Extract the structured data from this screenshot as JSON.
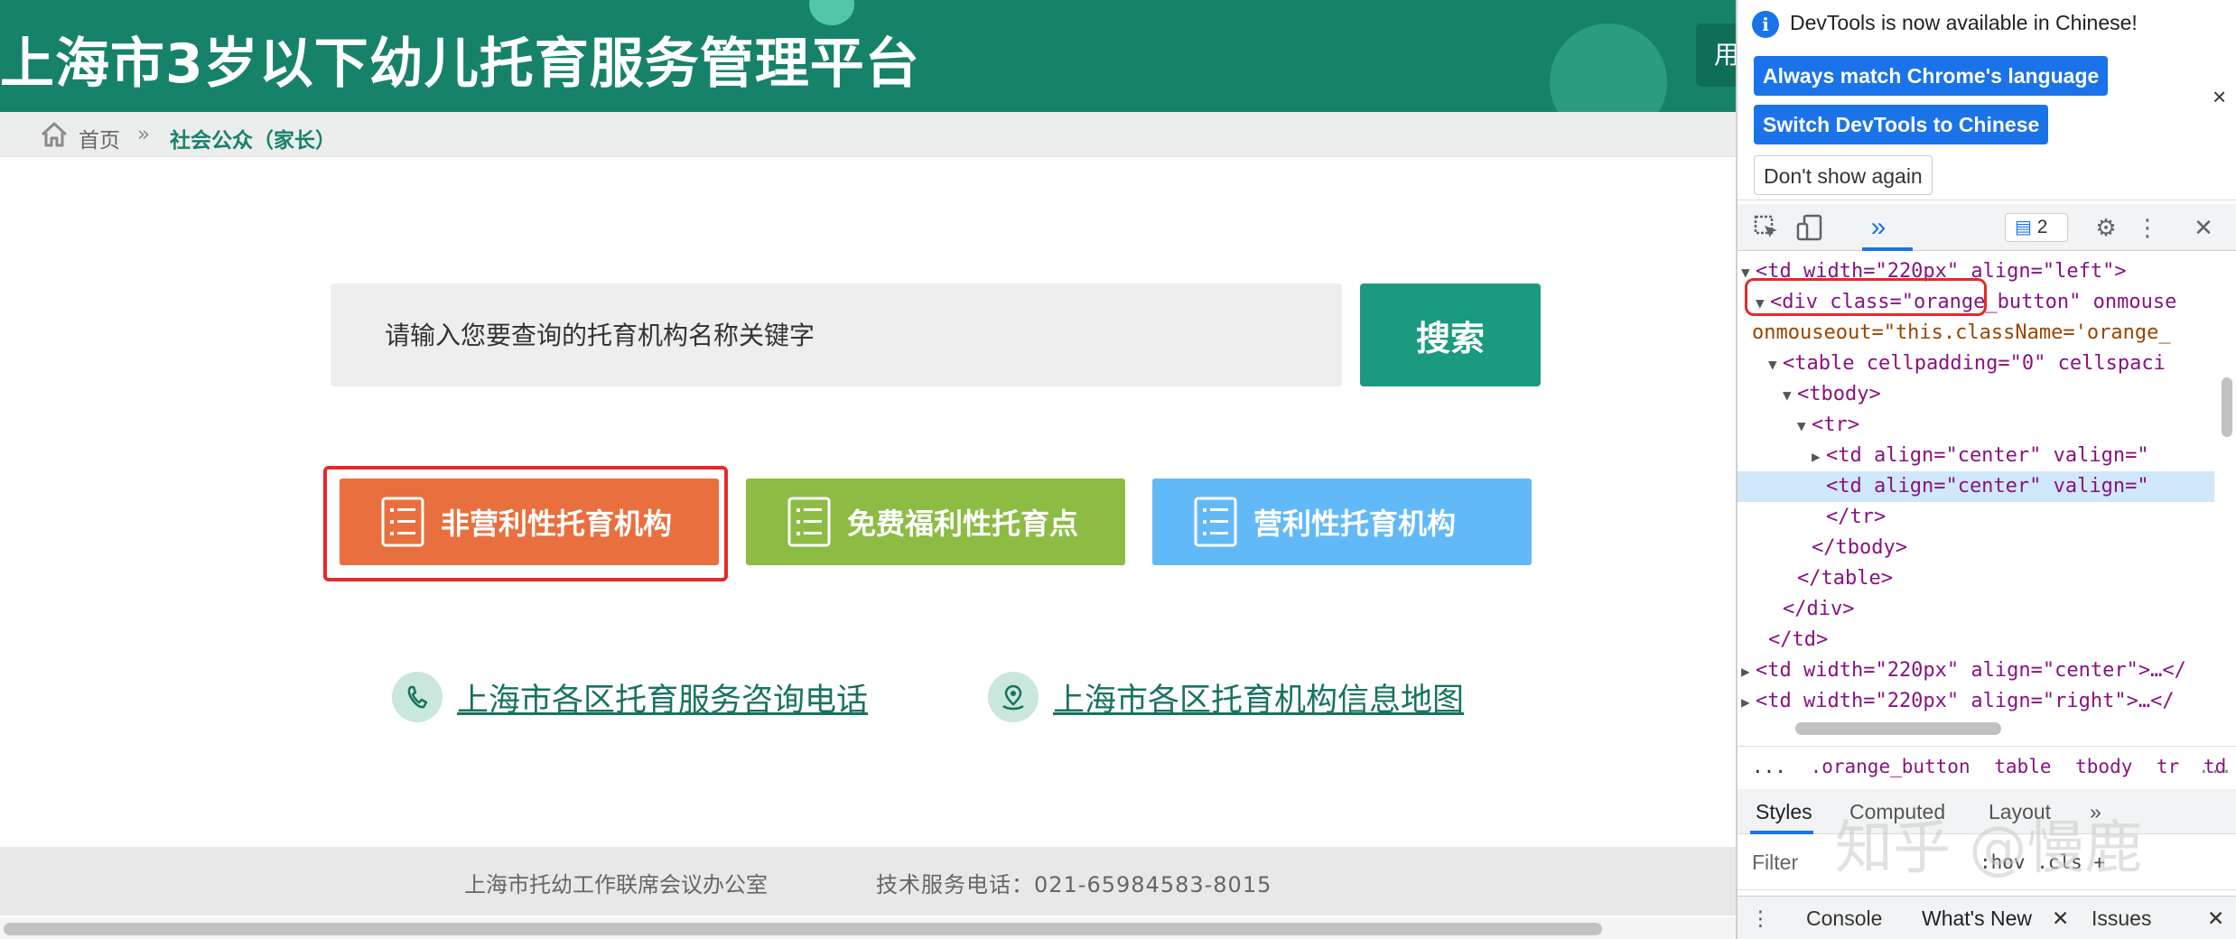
{
  "header": {
    "site_title": "上海市3岁以下幼儿托育服务管理平台",
    "user_button_label": "用"
  },
  "breadcrumb": {
    "home": "首页",
    "separator": "»",
    "current": "社会公众（家长）"
  },
  "search": {
    "placeholder": "请输入您要查询的托育机构名称关键字",
    "button_label": "搜索"
  },
  "categories": [
    {
      "label": "非营利性托育机构",
      "color": "#e96f3e"
    },
    {
      "label": "免费福利性托育点",
      "color": "#8cbc44"
    },
    {
      "label": "营利性托育机构",
      "color": "#62b9f8"
    }
  ],
  "links": {
    "phone": "上海市各区托育服务咨询电话",
    "map": "上海市各区托育机构信息地图"
  },
  "footer": {
    "office": "上海市托幼工作联席会议办公室",
    "phone": "技术服务电话：021-65984583-8015"
  },
  "devtools": {
    "banner": {
      "message": "DevTools is now available in Chinese!",
      "match_language": "Always match Chrome's language",
      "switch_chinese": "Switch DevTools to Chinese",
      "dont_show": "Don't show again",
      "close": "×"
    },
    "toolbar": {
      "more_panels": "»",
      "issues_count": "2"
    },
    "dom_lines": [
      "<td width=\"220px\" align=\"left\">",
      "<div class=\"orange_button\" onmouse",
      "onmouseout=\"this.className='orange_",
      "<table cellpadding=\"0\" cellspaci",
      "<tbody>",
      "<tr>",
      "<td align=\"center\" valign=\"",
      "<td align=\"center\" valign=\"",
      "</tr>",
      "</tbody>",
      "</table>",
      "</div>",
      "</td>",
      "<td width=\"220px\" align=\"center\">…</",
      "<td width=\"220px\" align=\"right\">…</"
    ],
    "crumbs": {
      "ellipsis_left": "...",
      "items": [
        ".orange_button",
        "table",
        "tbody",
        "tr",
        "td"
      ],
      "ellipsis_right": "..."
    },
    "styles_tabs": {
      "styles": "Styles",
      "computed": "Computed",
      "layout": "Layout",
      "more": "»"
    },
    "filter": {
      "label": "Filter",
      "hov": ":hov .cls +"
    },
    "drawer": {
      "console": "Console",
      "whats_new": "What's New",
      "issues": "Issues"
    }
  },
  "watermark": "知乎 @慢鹿"
}
